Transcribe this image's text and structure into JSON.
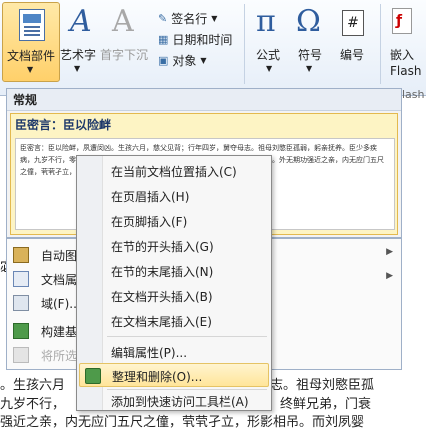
{
  "ribbon": {
    "doc_parts": "文档部件",
    "wordart": "艺术字",
    "dropcap": "首字下沉",
    "signature": "签名行",
    "datetime": "日期和时间",
    "object": "对象",
    "equation": "公式",
    "symbol": "符号",
    "numbering": "编号",
    "embed_flash_1": "嵌入",
    "embed_flash_2": "Flash",
    "partial_label": "lash"
  },
  "gallery": {
    "heading": "常规",
    "item_title": "臣密言：臣以险衅",
    "item_body": "臣密言：臣以险衅，夙遭闵凶。生孩六月，慈父见背；行年四岁，舅夺母志。祖母刘愍臣孤弱，躬亲抚养。臣少多疾病，九岁不行，零丁孤苦，至于成立。既无伯叔，终鲜兄弟，门衰祚薄，晚有儿息。外无期功强近之亲，内无应门五尺之僮，茕茕孑立，形影相吊。而刘夙婴疾病，常在床蓐，臣侍汤药，未曾废离。"
  },
  "lower_menu": {
    "items": [
      {
        "label": "自动图",
        "arrow": "▶"
      },
      {
        "label": "文档属",
        "arrow": "▶"
      },
      {
        "label": "域(F)..."
      },
      {
        "label": "构建基",
        "arrow": ""
      },
      {
        "label": "将所选"
      }
    ]
  },
  "doc": {
    "line1_left": "宓",
    "line2": "。生孩六月",
    "line2_right": "志。祖母刘愍臣孤",
    "line3": "九岁不行，",
    "line3_right": "终鲜兄弟，门衰",
    "line4": "强近之亲，内无应门五尺之僮，茕茕孑立，形影相吊。而刘夙婴"
  },
  "context_menu": {
    "items": [
      {
        "label": "在当前文档位置插入(C)"
      },
      {
        "label": "在页眉插入(H)"
      },
      {
        "label": "在页脚插入(F)"
      },
      {
        "label": "在节的开头插入(G)"
      },
      {
        "label": "在节的末尾插入(N)"
      },
      {
        "label": "在文档开头插入(B)"
      },
      {
        "label": "在文档末尾插入(E)"
      },
      {
        "label": "编辑属性(P)..."
      },
      {
        "label": "整理和删除(O)..."
      },
      {
        "label": "添加到快速访问工具栏(A)"
      }
    ]
  }
}
